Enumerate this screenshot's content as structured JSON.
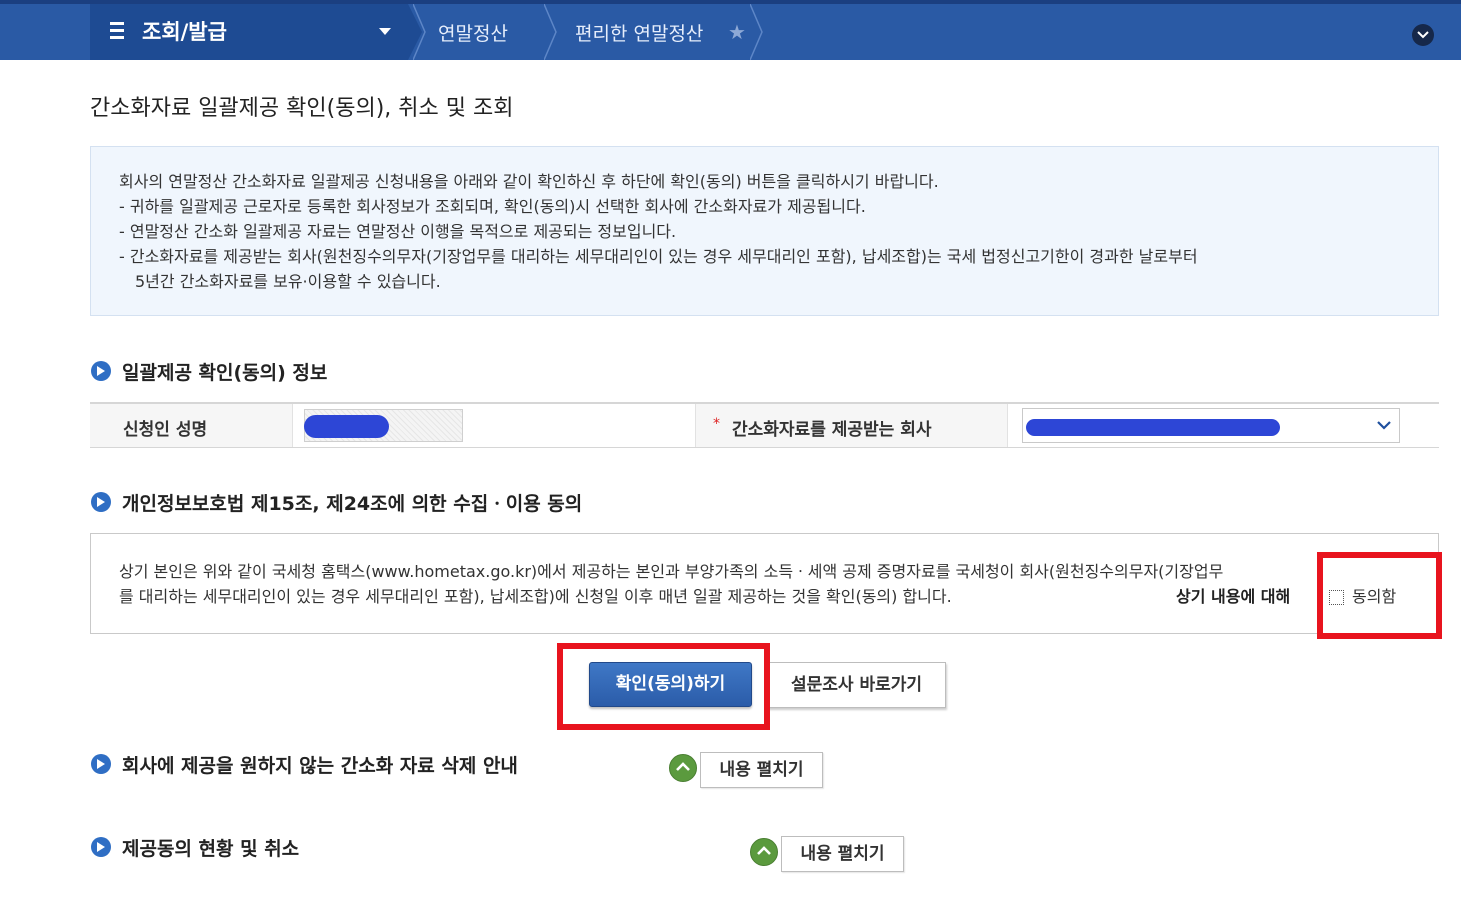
{
  "nav": {
    "main_menu": "조회/발급",
    "crumb1": "연말정산",
    "crumb2": "편리한 연말정산"
  },
  "page_title": "간소화자료 일괄제공 확인(동의), 취소 및 조회",
  "notice": {
    "lines": [
      "회사의 연말정산 간소화자료 일괄제공 신청내용을 아래와 같이 확인하신 후 하단에 확인(동의) 버튼을 클릭하시기 바랍니다.",
      "- 귀하를 일괄제공 근로자로 등록한 회사정보가 조회되며, 확인(동의)시 선택한 회사에 간소화자료가 제공됩니다.",
      "- 연말정산 간소화 일괄제공 자료는 연말정산 이행을 목적으로 제공되는 정보입니다.",
      "- 간소화자료를 제공받는 회사(원천징수의무자(기장업무를 대리하는 세무대리인이 있는 경우 세무대리인 포함), 납세조합)는 국세 법정신고기한이 경과한 날로부터",
      "5년간 간소화자료를 보유·이용할 수 있습니다."
    ]
  },
  "section1": {
    "title": "일괄제공 확인(동의) 정보",
    "applicant_label": "신청인 성명",
    "required_mark": "*",
    "company_label": "간소화자료를 제공받는 회사"
  },
  "section2": {
    "title": "개인정보보호법 제15조, 제24조에 의한 수집ㆍ이용 동의",
    "text_line1": "상기 본인은 위와 같이 국세청 홈택스(www.hometax.go.kr)에서 제공하는 본인과 부양가족의 소득ㆍ세액 공제 증명자료를 국세청이 회사(원천징수의무자(기장업무",
    "text_line2": "를 대리하는 세무대리인이 있는 경우 세무대리인 포함), 납세조합)에 신청일 이후 매년 일괄 제공하는 것을 확인(동의) 합니다.",
    "agree_label": "상기 내용에 대해",
    "agree_text": "동의함"
  },
  "buttons": {
    "confirm": "확인(동의)하기",
    "survey": "설문조사 바로가기"
  },
  "section3": {
    "title": "회사에 제공을 원하지 않는 간소화 자료 삭제 안내",
    "expand": "내용 펼치기"
  },
  "section4": {
    "title": "제공동의 현황 및 취소",
    "expand": "내용 펼치기"
  },
  "colors": {
    "nav_bg": "#2a5aa5",
    "highlight": "#e8141e",
    "primary_button": "#2f62ad"
  }
}
